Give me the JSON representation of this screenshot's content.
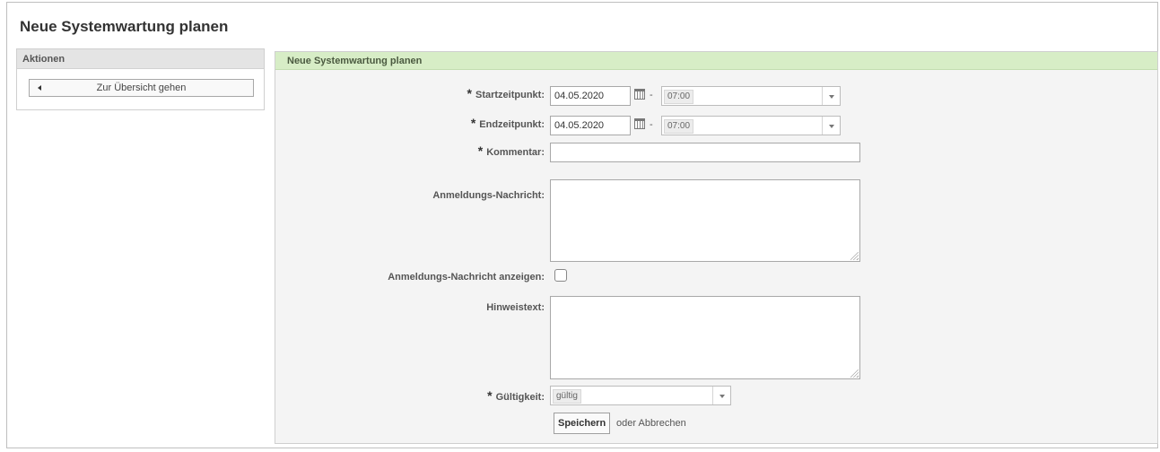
{
  "page": {
    "title": "Neue Systemwartung planen"
  },
  "sidebar": {
    "header": "Aktionen",
    "back_button_label": "Zur Übersicht gehen"
  },
  "panel": {
    "header": "Neue Systemwartung planen"
  },
  "form": {
    "required_mark": "*",
    "start": {
      "label": "Startzeitpunkt:",
      "date": "04.05.2020",
      "separator": "-",
      "time": "07:00"
    },
    "end": {
      "label": "Endzeitpunkt:",
      "date": "04.05.2020",
      "separator": "-",
      "time": "07:00"
    },
    "comment": {
      "label": "Kommentar:",
      "value": ""
    },
    "login_message": {
      "label": "Anmeldungs-Nachricht:",
      "value": ""
    },
    "show_login_message": {
      "label": "Anmeldungs-Nachricht anzeigen:",
      "checked": false
    },
    "notify_message": {
      "label": "Hinweistext:",
      "value": ""
    },
    "validity": {
      "label": "Gültigkeit:",
      "selected": "gültig"
    },
    "actions": {
      "save_label": "Speichern",
      "or_text": "oder",
      "cancel_label": "Abbrechen"
    }
  },
  "icons": {
    "calendar": "calendar-icon",
    "back_arrow": "arrow-left-icon",
    "dropdown_caret": "chevron-down-icon"
  },
  "colors": {
    "panel_header_bg": "#d7edc6",
    "panel_bg": "#f4f4f4",
    "sidebar_header_bg": "#e4e4e4"
  }
}
